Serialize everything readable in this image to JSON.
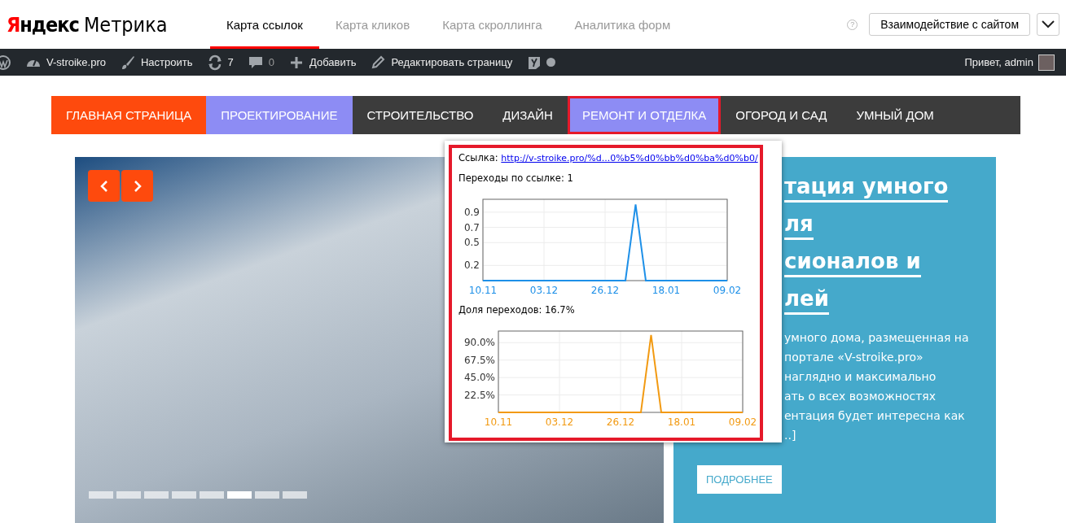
{
  "header": {
    "logo": {
      "brand": "Яндекс",
      "product": "Метрика"
    },
    "tabs": [
      {
        "label": "Карта ссылок",
        "selected": true
      },
      {
        "label": "Карта кликов",
        "selected": false
      },
      {
        "label": "Карта скроллинга",
        "selected": false
      },
      {
        "label": "Аналитика форм",
        "selected": false
      }
    ],
    "help": "?",
    "goal_button": "Взаимодействие с сайтом"
  },
  "admin_bar": {
    "items": [
      {
        "kind": "wp"
      },
      {
        "kind": "site",
        "label": "V-stroike.pro"
      },
      {
        "kind": "customize",
        "label": "Настроить"
      },
      {
        "kind": "updates",
        "label": "7"
      },
      {
        "kind": "comments",
        "label": "0"
      },
      {
        "kind": "add",
        "label": "Добавить"
      },
      {
        "kind": "edit",
        "label": "Редактировать страницу"
      },
      {
        "kind": "seo"
      }
    ],
    "greeting": "Привет, admin"
  },
  "site_nav": {
    "items": [
      {
        "label": "ГЛАВНАЯ СТРАНИЦА",
        "color": "#fe4a0d",
        "selected": false
      },
      {
        "label": "ПРОЕКТИРОВАНИЕ",
        "color": "#8d8cf4",
        "selected": false
      },
      {
        "label": "СТРОИТЕЛЬСТВО",
        "selected": false
      },
      {
        "label": "ДИЗАЙН",
        "selected": false
      },
      {
        "label": "РЕМОНТ И ОТДЕЛКА",
        "color": "#8d8cf4",
        "selected": true
      },
      {
        "label": "ОГОРОД И САД",
        "selected": false
      },
      {
        "label": "УМНЫЙ ДОМ",
        "selected": false
      }
    ]
  },
  "slider": {
    "dots": [
      {
        "selected": false
      },
      {
        "selected": false
      },
      {
        "selected": false
      },
      {
        "selected": false
      },
      {
        "selected": false
      },
      {
        "selected": true
      },
      {
        "selected": false
      },
      {
        "selected": false
      }
    ]
  },
  "feature": {
    "title_lines": [
      "тация умного",
      "ля",
      "сионалов и",
      "лей"
    ],
    "text_lines": [
      "умного дома, размещенная на",
      "портале «V-stroike.pro»",
      "наглядно и максимально",
      "ать о всех возможностях",
      "ентация будет интересна как",
      "..]"
    ],
    "button": "ПОДРОБНЕЕ"
  },
  "link_popup": {
    "link_label": "Ссылка:",
    "link_url": "http://v-stroike.pro/%d...0%b5%d0%bb%d0%ba%d0%b0/",
    "clicks_label": "Переходы по ссылке: 1",
    "clicks_chart": {
      "chart_data": {
        "type": "line",
        "grid": true,
        "categories": [
          "10.11",
          null,
          null,
          null,
          null,
          null,
          "03.12",
          null,
          null,
          null,
          null,
          null,
          "26.12",
          null,
          null,
          null,
          null,
          null,
          "18.01",
          null,
          null,
          null,
          null,
          null,
          "09.02"
        ],
        "series": [
          {
            "color": "#1e90e8",
            "values": [
              0,
              0,
              0,
              0,
              0,
              0,
              0,
              0,
              0,
              0,
              0,
              0,
              0,
              0,
              0,
              1,
              0,
              0,
              0,
              0,
              0,
              0,
              0,
              0,
              0
            ]
          }
        ],
        "ylim": [
          0,
          1.07
        ],
        "yticks": [
          0.2,
          0.5,
          0.7,
          0.9
        ]
      }
    },
    "share_label": "Доля переходов: 16.7%",
    "share_chart": {
      "chart_data": {
        "type": "line",
        "grid": true,
        "categories": [
          "10.11",
          null,
          null,
          null,
          null,
          null,
          "03.12",
          null,
          null,
          null,
          null,
          null,
          "26.12",
          null,
          null,
          null,
          null,
          null,
          "18.01",
          null,
          null,
          null,
          null,
          null,
          "09.02"
        ],
        "series": [
          {
            "color": "#f29a12",
            "values": [
              0,
              0,
              0,
              0,
              0,
              0,
              0,
              0,
              0,
              0,
              0,
              0,
              0,
              0,
              0,
              1,
              0,
              0,
              0,
              0,
              0,
              0,
              0,
              0,
              0
            ]
          }
        ],
        "ylim": [
          0,
          1.05
        ],
        "yticks": [
          {
            "value": 0.225,
            "label": "22.5%"
          },
          {
            "value": 0.45,
            "label": "45.0%"
          },
          {
            "value": 0.675,
            "label": "67.5%"
          },
          {
            "value": 0.9,
            "label": "90.0%"
          }
        ]
      }
    }
  }
}
